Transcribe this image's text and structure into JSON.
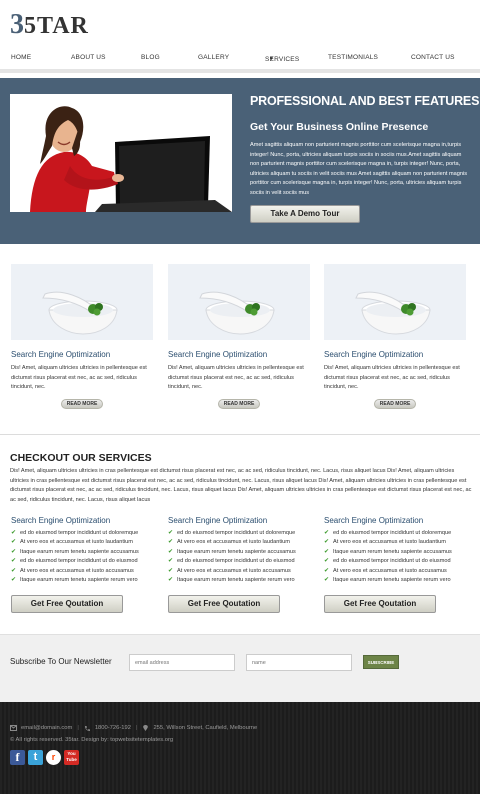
{
  "brand": {
    "number": "3",
    "name": "5TAR"
  },
  "nav": {
    "items": [
      "HOME",
      "ABOUT US",
      "BLOG",
      "GALLERY",
      "SERVICES",
      "TESTIMONIALS",
      "CONTACT US"
    ]
  },
  "hero": {
    "title": "PROFESSIONAL AND BEST FEATURES",
    "subtitle": "Get Your Business Online Presence",
    "text": "Amet sagittis aliquam non parturient magnis porttitor cum scelerisque magna in,turpis integer! Nunc, porta, ultricies aliquam turpis sociis in sociis mus.Amet sagittis aliquam non parturient magnis porttitor cum scelerisque magna in, turpis integer! Nunc, porta, ultricies aliquam tu sociis in velit sociis mus Amet sagittis aliquam non parturient magnis porttitor cum scelerisque magna in, turpis integer! Nunc, porta, ultricies aliquam turpis sociis in velit sociis mus",
    "button": "Take A Demo Tour"
  },
  "features": [
    {
      "title": "Search Engine Optimization",
      "text": "Dis! Amet, aliquam ultricies ultricies in pellentesque est dictumst risus placerat est nec, ac ac sed, ridiculus tincidunt, nec.",
      "button": "READ MORE"
    },
    {
      "title": "Search Engine Optimization",
      "text": "Dis! Amet, aliquam ultricies ultricies in pellentesque est dictumst risus placerat est nec, ac ac sed, ridiculus tincidunt, nec.",
      "button": "READ MORE"
    },
    {
      "title": "Search Engine Optimization",
      "text": "Dis! Amet, aliquam ultricies ultricies in pellentesque est dictumst risus placerat est nec, ac ac sed, ridiculus tincidunt, nec.",
      "button": "READ MORE"
    }
  ],
  "services": {
    "title": "CHECKOUT OUR SERVICES",
    "text": "Dis! Amet, aliquam ultricies ultricies in cras pellentesque est dictumst risus placerat est nec, ac ac sed, ridiculus tincidunt, nec. Lacus, risus aliquet lacus Dis! Amet, aliquam ultricies ultricies in cras pellentesque est dictumst risus placerat est nec, ac ac sed, ridiculus tincidunt, nec. Lacus, risus aliquet lacus Dis! Amet, aliquam ultricies ultricies in cras pellentesque est dictumst risus placerat est nec, ac ac sed, ridiculus tincidunt, nec. Lacus, risus aliquet lacus Dis! Amet, aliquam ultricies ultricies in cras pellentesque est dictumst risus placerat est nec, ac ac sed, ridiculus tincidunt, nec. Lacus, risus aliquet lacus",
    "columns": [
      {
        "title": "Search Engine Optimization",
        "items": [
          "ed do eiusmod tempor incididunt ut doloremque",
          "At vero eos et accusamus et iusto laudantium",
          "Itaque earum rerum tenetu sapiente accusamus",
          "ed do eiusmod tempor incididunt ut do eiusmod",
          "At vero eos et accusamus et iusto accusamus",
          "Itaque earum rerum tenetu sapiente rerum vero"
        ],
        "button": "Get Free Qoutation"
      },
      {
        "title": "Search Engine Optimization",
        "items": [
          "ed do eiusmod tempor incididunt ut doloremque",
          "At vero eos et accusamus et iusto laudantium",
          "Itaque earum rerum tenetu sapiente accusamus",
          "ed do eiusmod tempor incididunt ut do eiusmod",
          "At vero eos et accusamus et iusto accusamus",
          "Itaque earum rerum tenetu sapiente rerum vero"
        ],
        "button": "Get Free Qoutation"
      },
      {
        "title": "Search Engine Optimization",
        "items": [
          "ed do eiusmod tempor incididunt ut doloremque",
          "At vero eos et accusamus et iusto laudantium",
          "Itaque earum rerum tenetu sapiente accusamus",
          "ed do eiusmod tempor incididunt ut do eiusmod",
          "At vero eos et accusamus et iusto accusamus",
          "Itaque earum rerum tenetu sapiente rerum vero"
        ],
        "button": "Get Free Qoutation"
      }
    ]
  },
  "newsletter": {
    "title": "Subscribe To Our Newsletter",
    "email_placeholder": "email address",
    "name_placeholder": "name",
    "button": "SUBSCRIBE"
  },
  "footer": {
    "email": "email@domain.com",
    "phone": "1800-726-192",
    "address": "255, Willson Street, Caufield, Melbourne",
    "rights": "© All rights reserved. 35tar. Design by: topwebsitetemplates.org",
    "social": [
      {
        "icon": "facebook-icon",
        "glyph": "f",
        "color": "#3b5998"
      },
      {
        "icon": "twitter-icon",
        "glyph": "t",
        "color": "#3aa3d9"
      },
      {
        "icon": "reddit-icon",
        "glyph": "r",
        "color": "#ffffff"
      },
      {
        "icon": "youtube-icon",
        "glyph": "You Tube",
        "color": "#d42a24"
      }
    ]
  },
  "colors": {
    "hero_bg": "#4a6177",
    "heading_blue": "#2a4d6e",
    "subscribe_green": "#6d8447",
    "check_green": "#3a9a2a",
    "footer_bg": "#1f1f1f"
  }
}
